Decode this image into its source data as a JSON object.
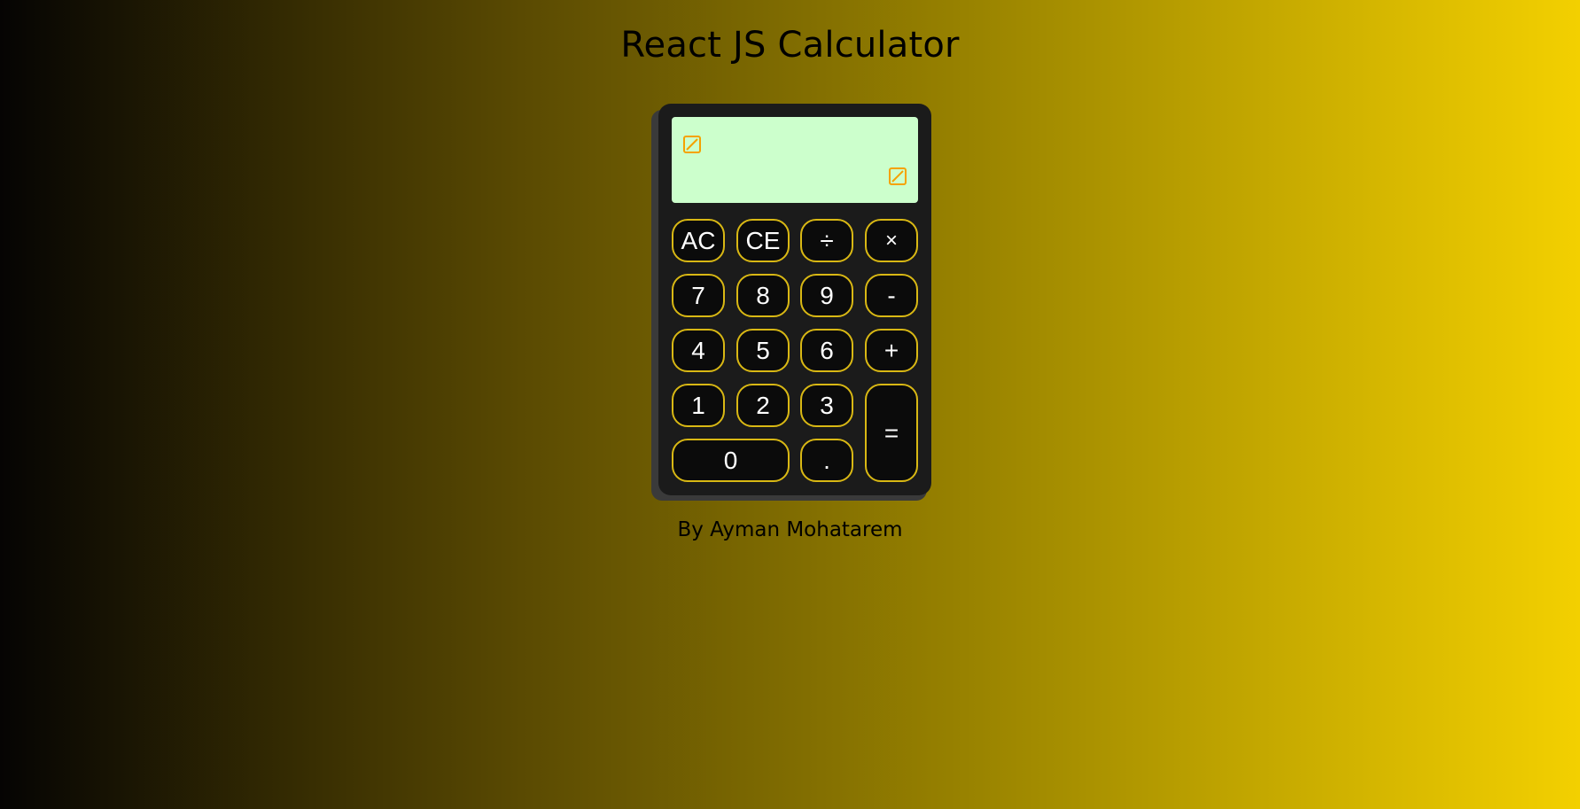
{
  "page": {
    "title": "React JS Calculator",
    "footer": "By Ayman Mohatarem"
  },
  "display": {
    "previous_operand": "",
    "current_operand": ""
  },
  "keys": {
    "ac": "AC",
    "ce": "CE",
    "divide": "÷",
    "multiply": "×",
    "seven": "7",
    "eight": "8",
    "nine": "9",
    "minus": "-",
    "four": "4",
    "five": "5",
    "six": "6",
    "plus": "+",
    "one": "1",
    "two": "2",
    "three": "3",
    "equals": "=",
    "zero": "0",
    "decimal": "."
  },
  "colors": {
    "display_background": "#ccffcc",
    "key_border": "#d9b814",
    "key_background": "#0b0b0b",
    "calculator_body": "#1b1b1b",
    "broken_image_icon": "#f5a200"
  },
  "icons": {
    "display_previous": "broken-image-icon",
    "display_current": "broken-image-icon"
  }
}
